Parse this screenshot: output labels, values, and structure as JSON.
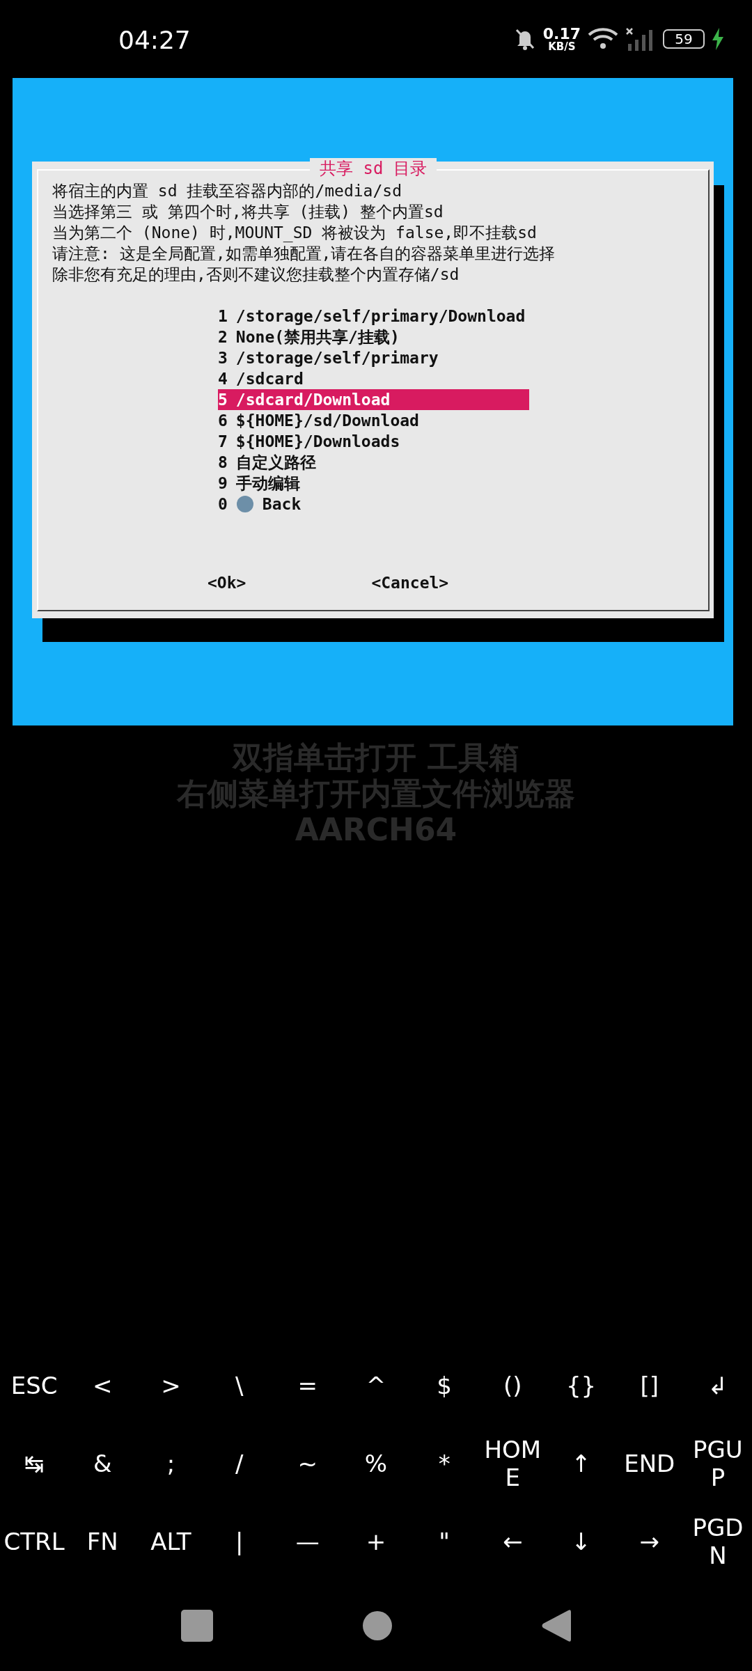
{
  "status_bar": {
    "time": "04:27",
    "speed": "0.17",
    "speed_unit": "KB/S",
    "battery": "59",
    "charging": true
  },
  "dialog": {
    "title": "共享 sd 目录",
    "lines": [
      "将宿主的内置 sd 挂载至容器内部的/media/sd",
      "当选择第三 或 第四个时,将共享 (挂载) 整个内置sd",
      "当为第二个 (None) 时,MOUNT_SD 将被设为 false,即不挂载sd",
      "请注意: 这是全局配置,如需单独配置,请在各自的容器菜单里进行选择",
      "除非您有充足的理由,否则不建议您挂载整个内置存储/sd"
    ],
    "items": [
      {
        "tag": "1",
        "label": "/storage/self/primary/Download",
        "selected": false,
        "kind": "text"
      },
      {
        "tag": "2",
        "label": "None(禁用共享/挂载)",
        "selected": false,
        "kind": "text"
      },
      {
        "tag": "3",
        "label": "/storage/self/primary",
        "selected": false,
        "kind": "text"
      },
      {
        "tag": "4",
        "label": "/sdcard",
        "selected": false,
        "kind": "text"
      },
      {
        "tag": "5",
        "label": "/sdcard/Download",
        "selected": true,
        "kind": "text"
      },
      {
        "tag": "6",
        "label": "${HOME}/sd/Download",
        "selected": false,
        "kind": "text"
      },
      {
        "tag": "7",
        "label": "${HOME}/Downloads",
        "selected": false,
        "kind": "text"
      },
      {
        "tag": "8",
        "label": "自定义路径",
        "selected": false,
        "kind": "text"
      },
      {
        "tag": "9",
        "label": "手动编辑",
        "selected": false,
        "kind": "text"
      },
      {
        "tag": "0",
        "label": "Back",
        "selected": false,
        "kind": "icon"
      }
    ],
    "buttons": [
      "<Ok>",
      "<Cancel>"
    ]
  },
  "hints": [
    "双指单击打开 工具箱",
    "右侧菜单打开内置文件浏览器",
    "AARCH64"
  ],
  "keyboard": [
    [
      "ESC",
      "<",
      ">",
      "\\",
      "=",
      "^",
      "$",
      "()",
      "{}",
      "[]",
      "↲"
    ],
    [
      "↹",
      "&",
      ";",
      "/",
      "~",
      "%",
      "*",
      "HOME",
      "↑",
      "END",
      "PGUP"
    ],
    [
      "CTRL",
      "FN",
      "ALT",
      "|",
      "—",
      "+",
      "\"",
      "←",
      "↓",
      "→",
      "PGDN"
    ]
  ]
}
